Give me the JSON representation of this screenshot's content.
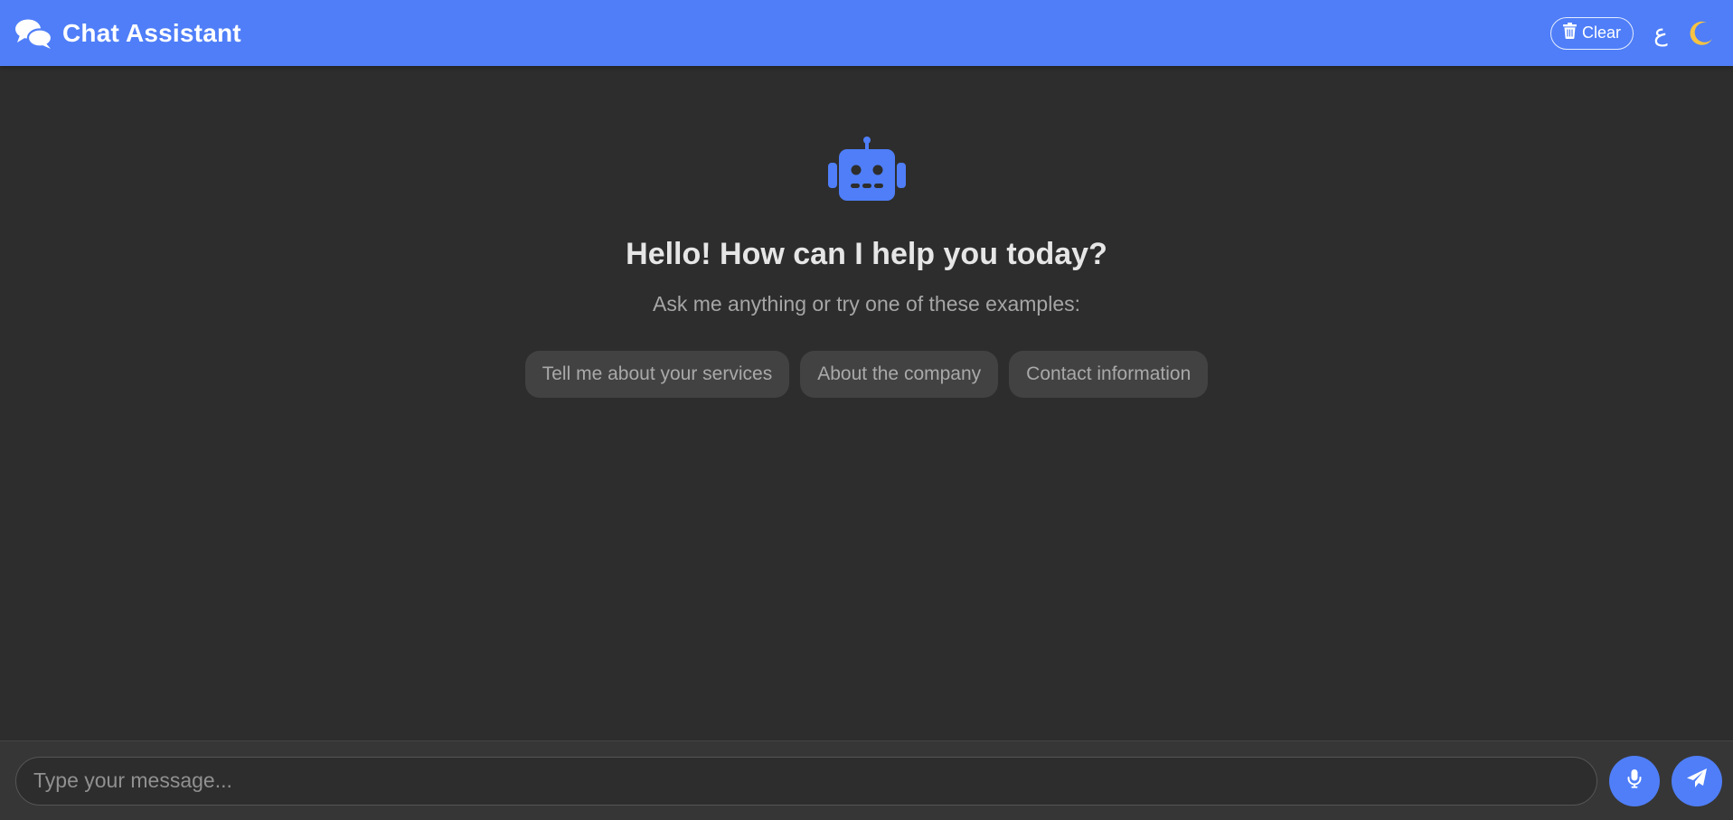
{
  "header": {
    "title": "Chat Assistant",
    "clear_label": "Clear",
    "language_toggle_label": "ع"
  },
  "welcome": {
    "title": "Hello! How can I help you today?",
    "subtitle": "Ask me anything or try one of these examples:",
    "suggestions": [
      "Tell me about your services",
      "About the company",
      "Contact information"
    ]
  },
  "composer": {
    "placeholder": "Type your message..."
  },
  "colors": {
    "accent": "#4f7ef8",
    "background": "#2d2d2d",
    "moon": "#f6c343"
  }
}
